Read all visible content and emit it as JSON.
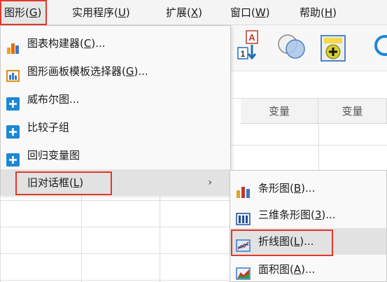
{
  "menubar": {
    "items": [
      {
        "label": "图形",
        "key": "G",
        "active": true
      },
      {
        "label": "实用程序",
        "key": "U",
        "active": false
      },
      {
        "label": "扩展",
        "key": "X",
        "active": false
      },
      {
        "label": "窗口",
        "key": "W",
        "active": false
      },
      {
        "label": "帮助",
        "key": "H",
        "active": false
      }
    ]
  },
  "toolbar": {
    "icons": [
      "sort-cases-icon",
      "venn-select-icon",
      "add-variable-icon",
      "circle-tool-icon"
    ],
    "sort_label_top": "A",
    "sort_label_bottom": "1"
  },
  "grid": {
    "column_headers": [
      "变量",
      "变量"
    ]
  },
  "menu": {
    "items": [
      {
        "label": "图表构建器",
        "key": "C",
        "suffix": "...",
        "icon": "chart-builder-icon"
      },
      {
        "label": "图形画板模板选择器",
        "key": "G",
        "suffix": "...",
        "icon": "template-chooser-icon"
      },
      {
        "label": "威布尔图",
        "key": "",
        "suffix": "...",
        "icon": "plus-icon"
      },
      {
        "label": "比较子组",
        "key": "",
        "suffix": "",
        "icon": "plus-icon"
      },
      {
        "label": "回归变量图",
        "key": "",
        "suffix": "",
        "icon": "plus-icon"
      },
      {
        "label": "旧对话框",
        "key": "L",
        "suffix": "",
        "icon": "",
        "submenu_arrow": "›"
      }
    ]
  },
  "submenu": {
    "items": [
      {
        "label": "条形图",
        "key": "B",
        "suffix": "...",
        "icon": "bar-chart-icon"
      },
      {
        "label": "三维条形图",
        "key": "3",
        "suffix": "...",
        "icon": "3d-bar-chart-icon"
      },
      {
        "label": "折线图",
        "key": "L",
        "suffix": "...",
        "icon": "line-chart-icon"
      },
      {
        "label": "面积图",
        "key": "A",
        "suffix": "...",
        "icon": "area-chart-icon"
      }
    ]
  },
  "colors": {
    "highlight_border": "#e0392b",
    "hover_bg": "#e2e2e2",
    "plus_icon": "#1e88d6"
  }
}
